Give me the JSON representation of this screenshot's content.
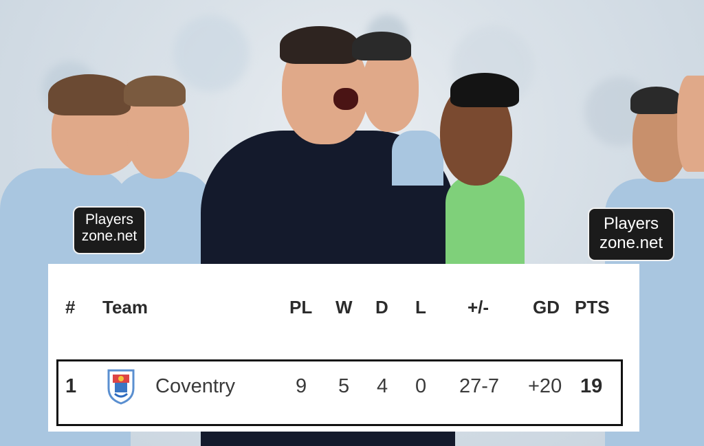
{
  "watermark": {
    "text_line1": "Players",
    "text_line2": "zone.net"
  },
  "table": {
    "headers": {
      "rank": "#",
      "team": "Team",
      "pl": "PL",
      "w": "W",
      "d": "D",
      "l": "L",
      "goals": "+/-",
      "gd": "GD",
      "pts": "PTS"
    },
    "row": {
      "rank": "1",
      "team": "Coventry",
      "pl": "9",
      "w": "5",
      "d": "4",
      "l": "0",
      "goals": "27-7",
      "gd": "+20",
      "pts": "19"
    },
    "crest_icon": "coventry-crest-icon"
  },
  "colors": {
    "jersey_light_blue": "#a9c6e0",
    "bib_green": "#7fd07a",
    "coat_dark": "#141a2c"
  }
}
